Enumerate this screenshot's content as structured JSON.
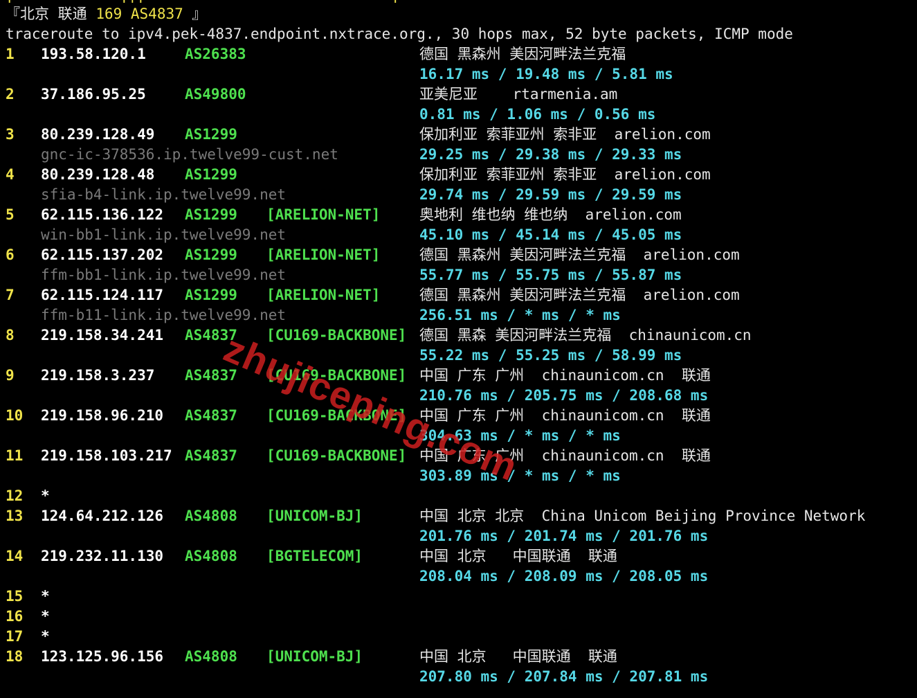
{
  "window": {
    "background": "#000000",
    "colors": {
      "hop": "#f0e34a",
      "ip": "#ffffff",
      "asn": "#4ee04e",
      "hostname": "#7a7a7a",
      "rtt": "#56d8e6",
      "geo": "#e6e6e6",
      "watermark": "#cd1e1e"
    }
  },
  "header": {
    "top_fragment": "[            ]|[                            ]",
    "tag_open": "『",
    "tag_city": "北京 联通",
    "tag_line": "169 AS4837",
    "tag_close": "』",
    "command": "traceroute to ipv4.pek-4837.endpoint.nxtrace.org., 30 hops max, 52 byte packets, ICMP mode"
  },
  "hops": [
    {
      "hop": "1",
      "ip": "193.58.120.1",
      "asn": "AS26383",
      "net": "",
      "geo": "德国 黑森州 美因河畔法兰克福",
      "host": "",
      "rtt": "16.17 ms / 19.48 ms / 5.81 ms"
    },
    {
      "hop": "2",
      "ip": "37.186.95.25",
      "asn": "AS49800",
      "net": "",
      "geo": "亚美尼亚    rtarmenia.am",
      "host": "",
      "rtt": "0.81 ms / 1.06 ms / 0.56 ms"
    },
    {
      "hop": "3",
      "ip": "80.239.128.49",
      "asn": "AS1299",
      "net": "",
      "geo": "保加利亚 索菲亚州 索非亚  arelion.com",
      "host": "gnc-ic-378536.ip.twelve99-cust.net",
      "rtt": "29.25 ms / 29.38 ms / 29.33 ms"
    },
    {
      "hop": "4",
      "ip": "80.239.128.48",
      "asn": "AS1299",
      "net": "",
      "geo": "保加利亚 索菲亚州 索非亚  arelion.com",
      "host": "sfia-b4-link.ip.twelve99.net",
      "rtt": "29.74 ms / 29.59 ms / 29.59 ms"
    },
    {
      "hop": "5",
      "ip": "62.115.136.122",
      "asn": "AS1299",
      "net": "[ARELION-NET]",
      "geo": "奥地利 维也纳 维也纳  arelion.com",
      "host": "win-bb1-link.ip.twelve99.net",
      "rtt": "45.10 ms / 45.14 ms / 45.05 ms"
    },
    {
      "hop": "6",
      "ip": "62.115.137.202",
      "asn": "AS1299",
      "net": "[ARELION-NET]",
      "geo": "德国 黑森州 美因河畔法兰克福  arelion.com",
      "host": "ffm-bb1-link.ip.twelve99.net",
      "rtt": "55.77 ms / 55.75 ms / 55.87 ms"
    },
    {
      "hop": "7",
      "ip": "62.115.124.117",
      "asn": "AS1299",
      "net": "[ARELION-NET]",
      "geo": "德国 黑森州 美因河畔法兰克福  arelion.com",
      "host": "ffm-b11-link.ip.twelve99.net",
      "rtt": "256.51 ms / * ms / * ms"
    },
    {
      "hop": "8",
      "ip": "219.158.34.241",
      "asn": "AS4837",
      "net": "[CU169-BACKBONE]",
      "geo": "德国 黑森 美因河畔法兰克福  chinaunicom.cn",
      "host": "",
      "rtt": "55.22 ms / 55.25 ms / 58.99 ms"
    },
    {
      "hop": "9",
      "ip": "219.158.3.237",
      "asn": "AS4837",
      "net": "[CU169-BACKBONE]",
      "geo": "中国 广东 广州  chinaunicom.cn  联通",
      "host": "",
      "rtt": "210.76 ms / 205.75 ms / 208.68 ms"
    },
    {
      "hop": "10",
      "ip": "219.158.96.210",
      "asn": "AS4837",
      "net": "[CU169-BACKBONE]",
      "geo": "中国 广东 广州  chinaunicom.cn  联通",
      "host": "",
      "rtt": "304.63 ms / * ms / * ms"
    },
    {
      "hop": "11",
      "ip": "219.158.103.217",
      "asn": "AS4837",
      "net": "[CU169-BACKBONE]",
      "geo": "中国 广东 广州  chinaunicom.cn  联通",
      "host": "",
      "rtt": "303.89 ms / * ms / * ms"
    },
    {
      "hop": "12",
      "ip": "*",
      "asn": "",
      "net": "",
      "geo": "",
      "host": "",
      "rtt": ""
    },
    {
      "hop": "13",
      "ip": "124.64.212.126",
      "asn": "AS4808",
      "net": "[UNICOM-BJ]",
      "geo": "中国 北京 北京  China Unicom Beijing Province Network",
      "host": "",
      "rtt": "201.76 ms / 201.74 ms / 201.76 ms"
    },
    {
      "hop": "14",
      "ip": "219.232.11.130",
      "asn": "AS4808",
      "net": "[BGTELECOM]",
      "geo": "中国 北京   中国联通  联通",
      "host": "",
      "rtt": "208.04 ms / 208.09 ms / 208.05 ms"
    },
    {
      "hop": "15",
      "ip": "*",
      "asn": "",
      "net": "",
      "geo": "",
      "host": "",
      "rtt": ""
    },
    {
      "hop": "16",
      "ip": "*",
      "asn": "",
      "net": "",
      "geo": "",
      "host": "",
      "rtt": ""
    },
    {
      "hop": "17",
      "ip": "*",
      "asn": "",
      "net": "",
      "geo": "",
      "host": "",
      "rtt": ""
    },
    {
      "hop": "18",
      "ip": "123.125.96.156",
      "asn": "AS4808",
      "net": "[UNICOM-BJ]",
      "geo": "中国 北京   中国联通  联通",
      "host": "",
      "rtt": "207.80 ms / 207.84 ms / 207.81 ms"
    }
  ],
  "watermark": {
    "text": "zhujiceping.com"
  }
}
